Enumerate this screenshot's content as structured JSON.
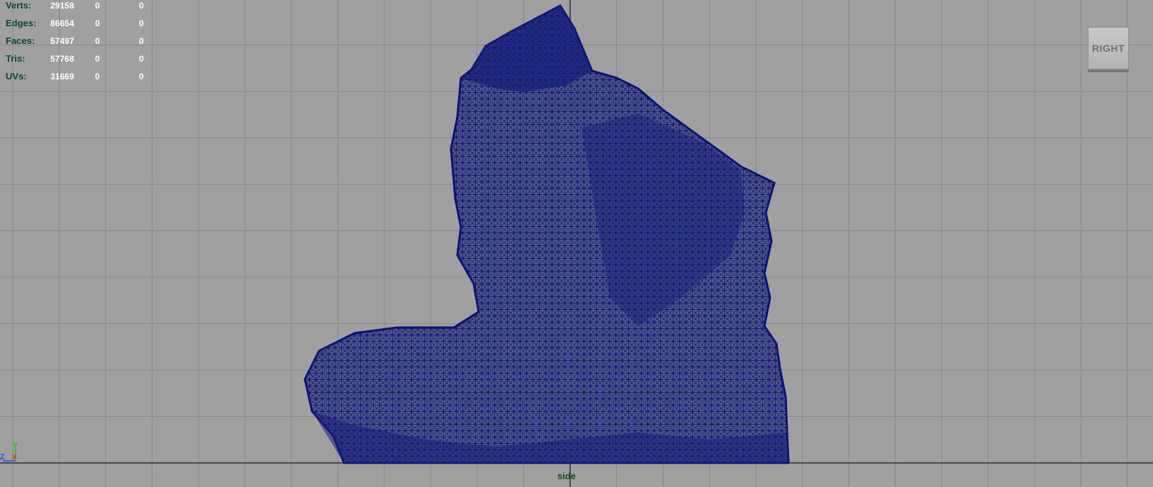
{
  "hud": {
    "rows": [
      {
        "label": "Verts:",
        "v1": "29158",
        "v2": "0",
        "v3": "0"
      },
      {
        "label": "Edges:",
        "v1": "86654",
        "v2": "0",
        "v3": "0"
      },
      {
        "label": "Faces:",
        "v1": "57497",
        "v2": "0",
        "v3": "0"
      },
      {
        "label": "Tris:",
        "v1": "57768",
        "v2": "0",
        "v3": "0"
      },
      {
        "label": "UVs:",
        "v1": "31669",
        "v2": "0",
        "v3": "0"
      }
    ]
  },
  "viewcube": {
    "label": "RIGHT"
  },
  "camera": {
    "name": "side"
  },
  "axis": {
    "vertical": "Y",
    "horizontal": "Z",
    "depth": "X"
  },
  "colors": {
    "background": "#a0a0a0",
    "grid": "#888888",
    "mesh": "#101a8a",
    "hud_label": "#0b4a2b",
    "hud_value": "#ffffff"
  },
  "icons": {
    "axis_gizmo": "axis-gizmo-icon"
  }
}
